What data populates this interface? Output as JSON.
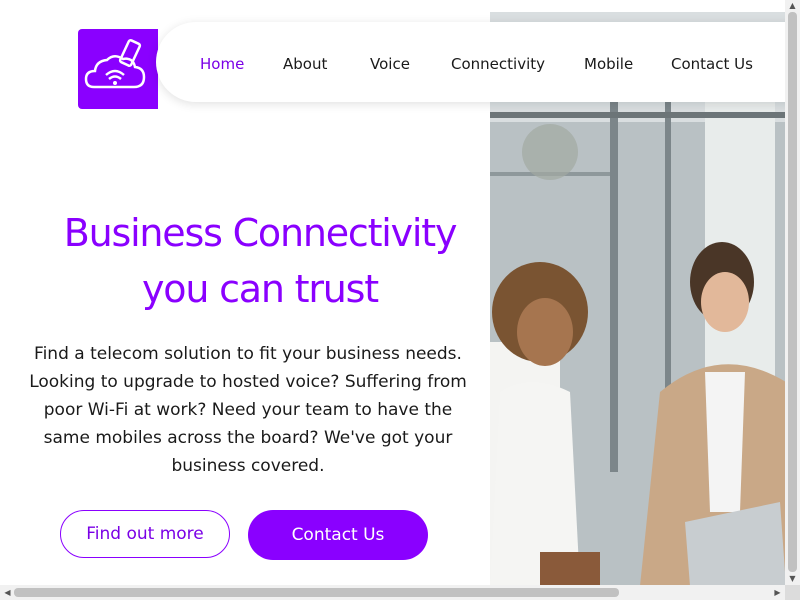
{
  "brand": {
    "accent": "#8a00ff",
    "logo_icon": "cloud-wifi-phone-icon"
  },
  "nav": {
    "items": [
      {
        "label": "Home",
        "active": true
      },
      {
        "label": "About",
        "active": false
      },
      {
        "label": "Voice",
        "active": false
      },
      {
        "label": "Connectivity",
        "active": false
      },
      {
        "label": "Mobile",
        "active": false
      },
      {
        "label": "Contact Us",
        "active": false
      }
    ]
  },
  "hero": {
    "heading_line1": "Business Connectivity",
    "heading_line2": "you can trust",
    "body": "Find a telecom solution to fit your business needs. Looking to upgrade to hosted voice? Suffering from poor Wi-Fi at work? Need your team to have the same mobiles across the board? We've got your business covered.",
    "primary_button": "Find out more",
    "secondary_button": "Contact Us"
  }
}
